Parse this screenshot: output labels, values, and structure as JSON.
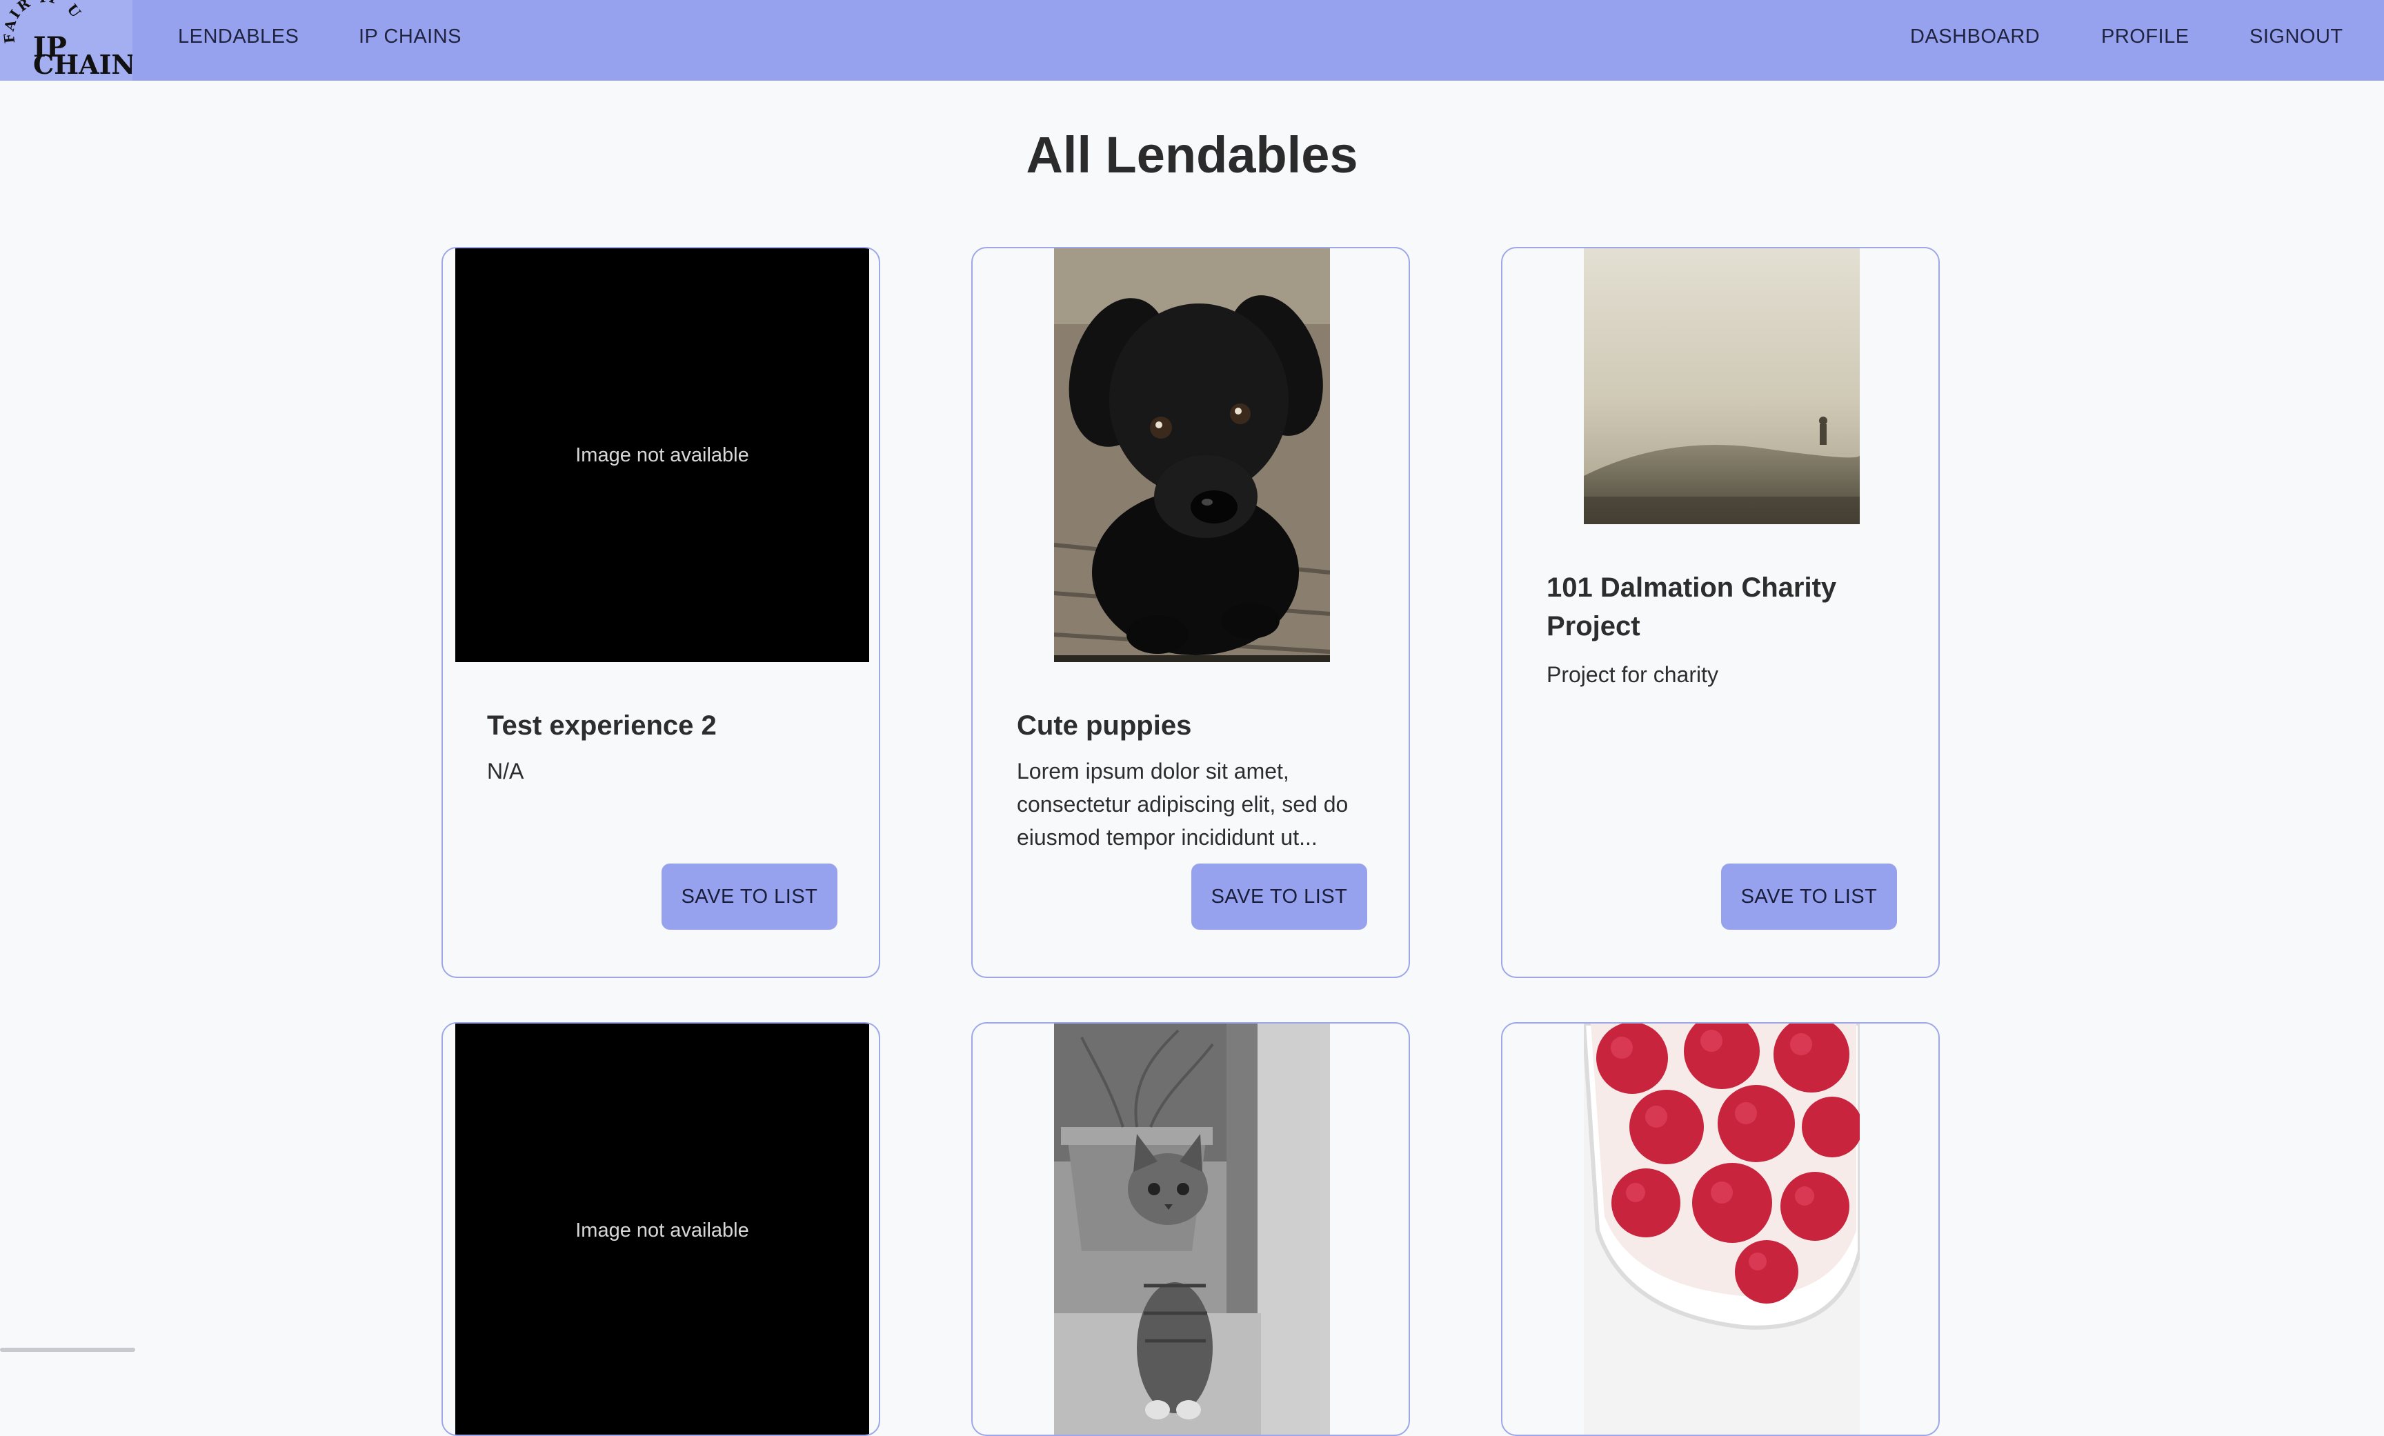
{
  "logo": {
    "arc_text": "FAIR IP USE",
    "line1": "IP",
    "line2": "CHAIN"
  },
  "nav": {
    "left": [
      "LENDABLES",
      "IP CHAINS"
    ],
    "right": [
      "DASHBOARD",
      "PROFILE",
      "SIGNOUT"
    ]
  },
  "page": {
    "title": "All Lendables"
  },
  "image_placeholder": "Image not available",
  "cards": [
    {
      "title": "Test experience 2",
      "description": "N/A",
      "button": "SAVE TO LIST",
      "image": "none"
    },
    {
      "title": "Cute puppies",
      "description": "Lorem ipsum dolor sit amet, consectetur adipiscing elit, sed do eiusmod tempor incididunt ut...",
      "button": "SAVE TO LIST",
      "image": "black-puppy-photo"
    },
    {
      "title": "101 Dalmation Charity Project",
      "description": "Project for charity",
      "button": "SAVE TO LIST",
      "image": "foggy-hill-photo"
    },
    {
      "image": "none"
    },
    {
      "image": "kitten-photo"
    },
    {
      "image": "raspberries-bowl-photo"
    }
  ],
  "colors": {
    "navbar": "#97a2ee",
    "button": "#97a2ee",
    "card_border": "#9ea7e8",
    "page_bg": "#f8f9fa"
  }
}
